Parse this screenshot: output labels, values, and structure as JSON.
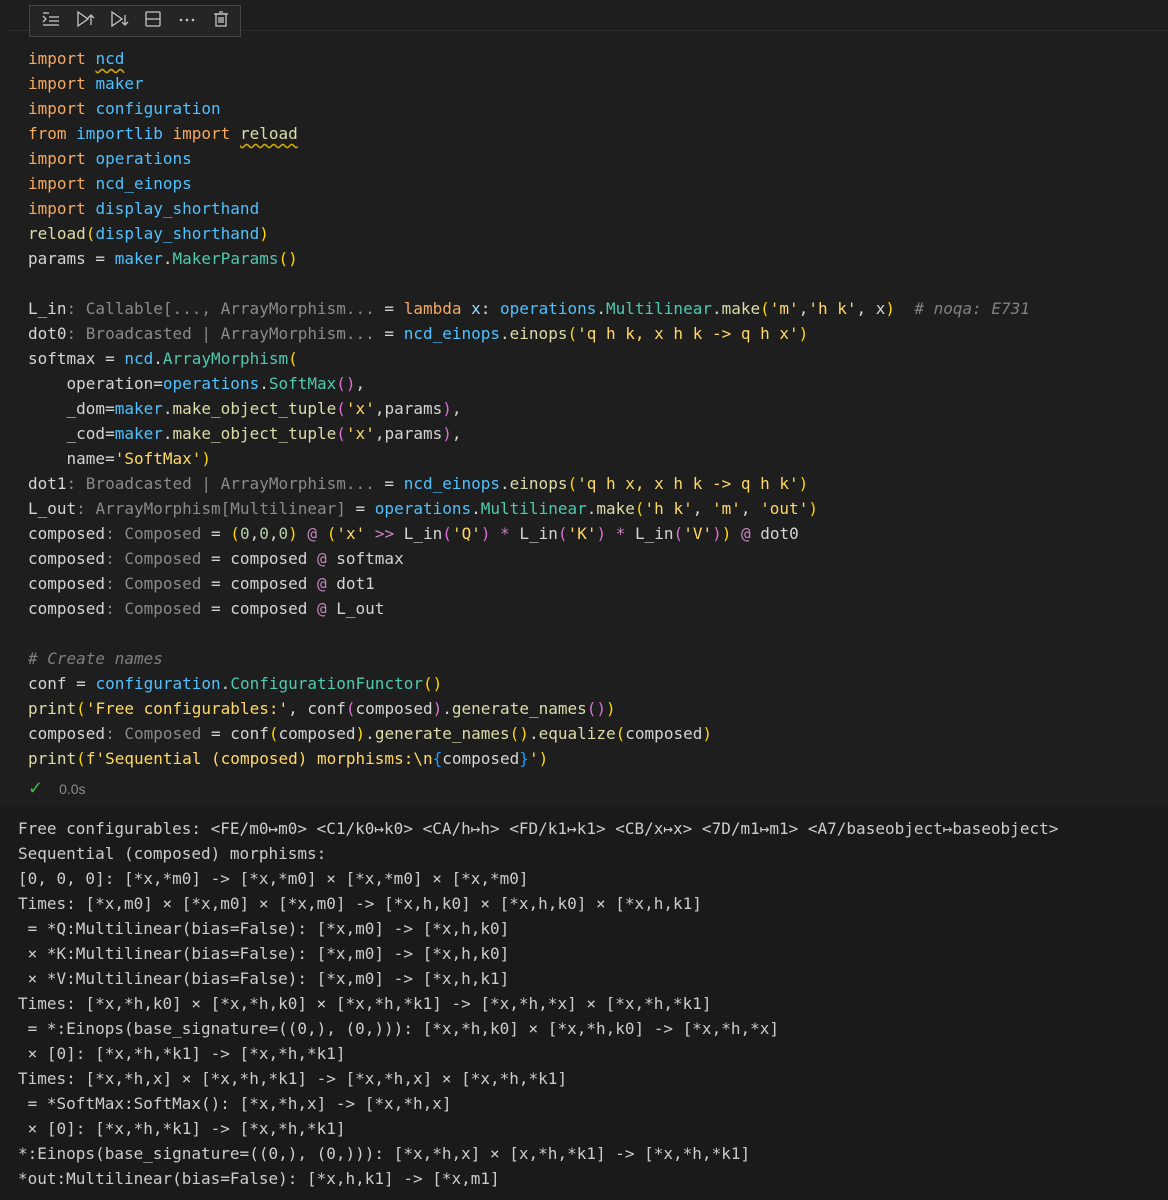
{
  "toolbar": {
    "items": [
      {
        "icon": "run-by-line-icon"
      },
      {
        "icon": "execute-above-icon"
      },
      {
        "icon": "execute-below-icon"
      },
      {
        "icon": "split-cell-icon"
      },
      {
        "icon": "more-actions-icon"
      },
      {
        "icon": "delete-cell-icon"
      }
    ]
  },
  "code_lines": [
    [
      [
        "import ",
        "kw"
      ],
      [
        "ncd",
        "mod squig"
      ]
    ],
    [
      [
        "import ",
        "kw"
      ],
      [
        "maker",
        "mod"
      ]
    ],
    [
      [
        "import ",
        "kw"
      ],
      [
        "configuration",
        "mod"
      ]
    ],
    [
      [
        "from ",
        "kw"
      ],
      [
        "importlib",
        "mod"
      ],
      [
        " import ",
        "kw"
      ],
      [
        "reload",
        "fn squig"
      ]
    ],
    [
      [
        "import ",
        "kw"
      ],
      [
        "operations",
        "mod"
      ]
    ],
    [
      [
        "import ",
        "kw"
      ],
      [
        "ncd_einops",
        "mod"
      ]
    ],
    [
      [
        "import ",
        "kw"
      ],
      [
        "display_shorthand",
        "mod"
      ]
    ],
    [
      [
        "reload",
        "fn"
      ],
      [
        "(",
        "br1"
      ],
      [
        "display_shorthand",
        "mod"
      ],
      [
        ")",
        "br1"
      ]
    ],
    [
      [
        "params",
        "op"
      ],
      [
        " = ",
        "op"
      ],
      [
        "maker",
        "mod"
      ],
      [
        ".",
        "op"
      ],
      [
        "MakerParams",
        "cls"
      ],
      [
        "()",
        "br1"
      ]
    ],
    [],
    [
      [
        "L_in",
        "op"
      ],
      [
        ": Callable[..., ArrayMorphism...",
        "hint"
      ],
      [
        " = ",
        "op"
      ],
      [
        "lambda ",
        "kw"
      ],
      [
        "x",
        "name"
      ],
      [
        ": ",
        "op"
      ],
      [
        "operations",
        "mod"
      ],
      [
        ".",
        "op"
      ],
      [
        "Multilinear",
        "cls"
      ],
      [
        ".",
        "op"
      ],
      [
        "make",
        "fn"
      ],
      [
        "(",
        "br1"
      ],
      [
        "'m'",
        "str"
      ],
      [
        ",",
        "op"
      ],
      [
        "'h k'",
        "str"
      ],
      [
        ", x",
        "op"
      ],
      [
        ")",
        "br1"
      ],
      [
        "  # noqa: E731",
        "cmt2"
      ]
    ],
    [
      [
        "dot0",
        "op"
      ],
      [
        ": Broadcasted | ArrayMorphism...",
        "hint"
      ],
      [
        " = ",
        "op"
      ],
      [
        "ncd_einops",
        "mod"
      ],
      [
        ".",
        "op"
      ],
      [
        "einops",
        "fn"
      ],
      [
        "(",
        "br1"
      ],
      [
        "'q h k, x h k -> q h x'",
        "str"
      ],
      [
        ")",
        "br1"
      ]
    ],
    [
      [
        "softmax",
        "op"
      ],
      [
        " = ",
        "op"
      ],
      [
        "ncd",
        "mod"
      ],
      [
        ".",
        "op"
      ],
      [
        "ArrayMorphism",
        "cls"
      ],
      [
        "(",
        "br1"
      ]
    ],
    [
      [
        "    operation",
        "op"
      ],
      [
        "=",
        "op"
      ],
      [
        "operations",
        "mod"
      ],
      [
        ".",
        "op"
      ],
      [
        "SoftMax",
        "cls"
      ],
      [
        "()",
        "br2"
      ],
      [
        ",",
        "op"
      ]
    ],
    [
      [
        "    _dom",
        "op"
      ],
      [
        "=",
        "op"
      ],
      [
        "maker",
        "mod"
      ],
      [
        ".",
        "op"
      ],
      [
        "make_object_tuple",
        "fn"
      ],
      [
        "(",
        "br2"
      ],
      [
        "'x'",
        "str"
      ],
      [
        ",params",
        "op"
      ],
      [
        ")",
        "br2"
      ],
      [
        ",",
        "op"
      ]
    ],
    [
      [
        "    _cod",
        "op"
      ],
      [
        "=",
        "op"
      ],
      [
        "maker",
        "mod"
      ],
      [
        ".",
        "op"
      ],
      [
        "make_object_tuple",
        "fn"
      ],
      [
        "(",
        "br2"
      ],
      [
        "'x'",
        "str"
      ],
      [
        ",params",
        "op"
      ],
      [
        ")",
        "br2"
      ],
      [
        ",",
        "op"
      ]
    ],
    [
      [
        "    name",
        "op"
      ],
      [
        "=",
        "op"
      ],
      [
        "'SoftMax'",
        "str"
      ],
      [
        ")",
        "br1"
      ]
    ],
    [
      [
        "dot1",
        "op"
      ],
      [
        ": Broadcasted | ArrayMorphism...",
        "hint"
      ],
      [
        " = ",
        "op"
      ],
      [
        "ncd_einops",
        "mod"
      ],
      [
        ".",
        "op"
      ],
      [
        "einops",
        "fn"
      ],
      [
        "(",
        "br1"
      ],
      [
        "'q h x, x h k -> q h k'",
        "str"
      ],
      [
        ")",
        "br1"
      ]
    ],
    [
      [
        "L_out",
        "op"
      ],
      [
        ": ArrayMorphism[Multilinear]",
        "hint"
      ],
      [
        " = ",
        "op"
      ],
      [
        "operations",
        "mod"
      ],
      [
        ".",
        "op"
      ],
      [
        "Multilinear",
        "cls"
      ],
      [
        ".",
        "op"
      ],
      [
        "make",
        "fn"
      ],
      [
        "(",
        "br1"
      ],
      [
        "'h k'",
        "str"
      ],
      [
        ", ",
        "op"
      ],
      [
        "'m'",
        "str"
      ],
      [
        ", ",
        "op"
      ],
      [
        "'out'",
        "str"
      ],
      [
        ")",
        "br1"
      ]
    ],
    [
      [
        "composed",
        "op"
      ],
      [
        ": Composed",
        "hint"
      ],
      [
        " = ",
        "op"
      ],
      [
        "(",
        "br1"
      ],
      [
        "0",
        "num"
      ],
      [
        ",",
        "op"
      ],
      [
        "0",
        "num"
      ],
      [
        ",",
        "op"
      ],
      [
        "0",
        "num"
      ],
      [
        ")",
        "br1"
      ],
      [
        " @ ",
        "ctl"
      ],
      [
        "(",
        "br1"
      ],
      [
        "'x'",
        "str"
      ],
      [
        " >> ",
        "ctl"
      ],
      [
        "L_in",
        "op"
      ],
      [
        "(",
        "br2"
      ],
      [
        "'Q'",
        "str"
      ],
      [
        ")",
        "br2"
      ],
      [
        " * ",
        "ctl"
      ],
      [
        "L_in",
        "op"
      ],
      [
        "(",
        "br2"
      ],
      [
        "'K'",
        "str"
      ],
      [
        ")",
        "br2"
      ],
      [
        " * ",
        "ctl"
      ],
      [
        "L_in",
        "op"
      ],
      [
        "(",
        "br2"
      ],
      [
        "'V'",
        "str"
      ],
      [
        ")",
        "br2"
      ],
      [
        ")",
        "br1"
      ],
      [
        " @ ",
        "ctl"
      ],
      [
        "dot0",
        "op"
      ]
    ],
    [
      [
        "composed",
        "op"
      ],
      [
        ": Composed",
        "hint"
      ],
      [
        " = ",
        "op"
      ],
      [
        "composed",
        "op"
      ],
      [
        " @ ",
        "ctl"
      ],
      [
        "softmax",
        "op"
      ]
    ],
    [
      [
        "composed",
        "op"
      ],
      [
        ": Composed",
        "hint"
      ],
      [
        " = ",
        "op"
      ],
      [
        "composed",
        "op"
      ],
      [
        " @ ",
        "ctl"
      ],
      [
        "dot1",
        "op"
      ]
    ],
    [
      [
        "composed",
        "op"
      ],
      [
        ": Composed",
        "hint"
      ],
      [
        " = ",
        "op"
      ],
      [
        "composed",
        "op"
      ],
      [
        " @ ",
        "ctl"
      ],
      [
        "L_out",
        "op"
      ]
    ],
    [],
    [
      [
        "# Create names",
        "cmt2"
      ]
    ],
    [
      [
        "conf",
        "op"
      ],
      [
        " = ",
        "op"
      ],
      [
        "configuration",
        "mod"
      ],
      [
        ".",
        "op"
      ],
      [
        "ConfigurationFunctor",
        "cls"
      ],
      [
        "()",
        "br1"
      ]
    ],
    [
      [
        "print",
        "fn"
      ],
      [
        "(",
        "br1"
      ],
      [
        "'Free configurables:'",
        "str"
      ],
      [
        ", ",
        "op"
      ],
      [
        "conf",
        "op"
      ],
      [
        "(",
        "br2"
      ],
      [
        "composed",
        "op"
      ],
      [
        ")",
        "br2"
      ],
      [
        ".",
        "op"
      ],
      [
        "generate_names",
        "fn"
      ],
      [
        "()",
        "br2"
      ],
      [
        ")",
        "br1"
      ]
    ],
    [
      [
        "composed",
        "op"
      ],
      [
        ": Composed",
        "hint"
      ],
      [
        " = ",
        "op"
      ],
      [
        "conf",
        "op"
      ],
      [
        "(",
        "br1"
      ],
      [
        "composed",
        "op"
      ],
      [
        ")",
        "br1"
      ],
      [
        ".",
        "op"
      ],
      [
        "generate_names",
        "fn"
      ],
      [
        "()",
        "br1"
      ],
      [
        ".",
        "op"
      ],
      [
        "equalize",
        "fn"
      ],
      [
        "(",
        "br1"
      ],
      [
        "composed",
        "op"
      ],
      [
        ")",
        "br1"
      ]
    ],
    [
      [
        "print",
        "fn"
      ],
      [
        "(",
        "br1"
      ],
      [
        "f'Sequential (composed) morphisms:\\n",
        "str"
      ],
      [
        "{",
        "br3"
      ],
      [
        "composed",
        "op"
      ],
      [
        "}",
        "br3"
      ],
      [
        "'",
        "str"
      ],
      [
        ")",
        "br1"
      ]
    ]
  ],
  "status": {
    "check": "✓",
    "time": "0.0s"
  },
  "output_lines": [
    "Free configurables: <FE/m0↦m0> <C1/k0↦k0> <CA/h↦h> <FD/k1↦k1> <CB/x↦x> <7D/m1↦m1> <A7/baseobject↦baseobject>",
    "Sequential (composed) morphisms:",
    "[0, 0, 0]: [*x,*m0] -> [*x,*m0] × [*x,*m0] × [*x,*m0]",
    "Times: [*x,m0] × [*x,m0] × [*x,m0] -> [*x,h,k0] × [*x,h,k0] × [*x,h,k1]",
    " = *Q:Multilinear(bias=False): [*x,m0] -> [*x,h,k0]",
    " × *K:Multilinear(bias=False): [*x,m0] -> [*x,h,k0]",
    " × *V:Multilinear(bias=False): [*x,m0] -> [*x,h,k1]",
    "Times: [*x,*h,k0] × [*x,*h,k0] × [*x,*h,*k1] -> [*x,*h,*x] × [*x,*h,*k1]",
    " = *:Einops(base_signature=((0,), (0,))): [*x,*h,k0] × [*x,*h,k0] -> [*x,*h,*x]",
    " × [0]: [*x,*h,*k1] -> [*x,*h,*k1]",
    "Times: [*x,*h,x] × [*x,*h,*k1] -> [*x,*h,x] × [*x,*h,*k1]",
    " = *SoftMax:SoftMax(): [*x,*h,x] -> [*x,*h,x]",
    " × [0]: [*x,*h,*k1] -> [*x,*h,*k1]",
    "*:Einops(base_signature=((0,), (0,))): [*x,*h,x] × [x,*h,*k1] -> [*x,*h,*k1]",
    "*out:Multilinear(bias=False): [*x,h,k1] -> [*x,m1]"
  ]
}
